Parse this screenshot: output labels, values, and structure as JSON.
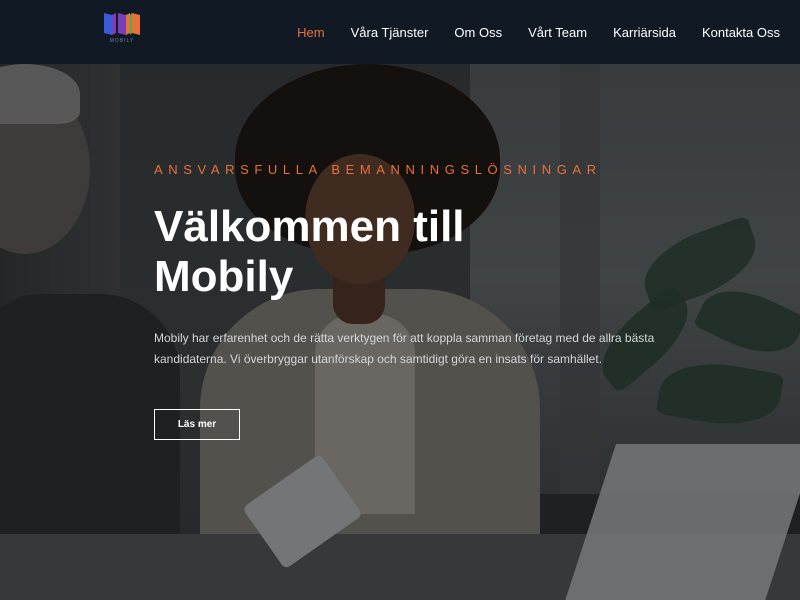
{
  "brand": {
    "name": "Mobily",
    "logo_text": "MOBILY",
    "logo_colors": [
      "#3b5bdb",
      "#7b3fb5",
      "#e8703a",
      "#4caf50"
    ]
  },
  "nav": {
    "items": [
      {
        "label": "Hem",
        "active": true
      },
      {
        "label": "Våra Tjänster",
        "active": false
      },
      {
        "label": "Om Oss",
        "active": false
      },
      {
        "label": "Vårt Team",
        "active": false
      },
      {
        "label": "Karriärsida",
        "active": false
      },
      {
        "label": "Kontakta Oss",
        "active": false
      }
    ],
    "active_color": "#e8703a"
  },
  "hero": {
    "tagline": "ANSVARSFULLA BEMANNINGSLÖSNINGAR",
    "headline_line1": "Välkommen till",
    "headline_line2": "Mobily",
    "description": "Mobily har erfarenhet och de rätta verktygen för att koppla samman företag med de allra bästa kandidaterna. Vi överbryggar utanförskap och samtidigt göra en insats för samhället.",
    "cta_label": "Läs mer"
  },
  "colors": {
    "nav_bg": "#111a24",
    "accent": "#e8703a",
    "text": "#ffffff"
  }
}
